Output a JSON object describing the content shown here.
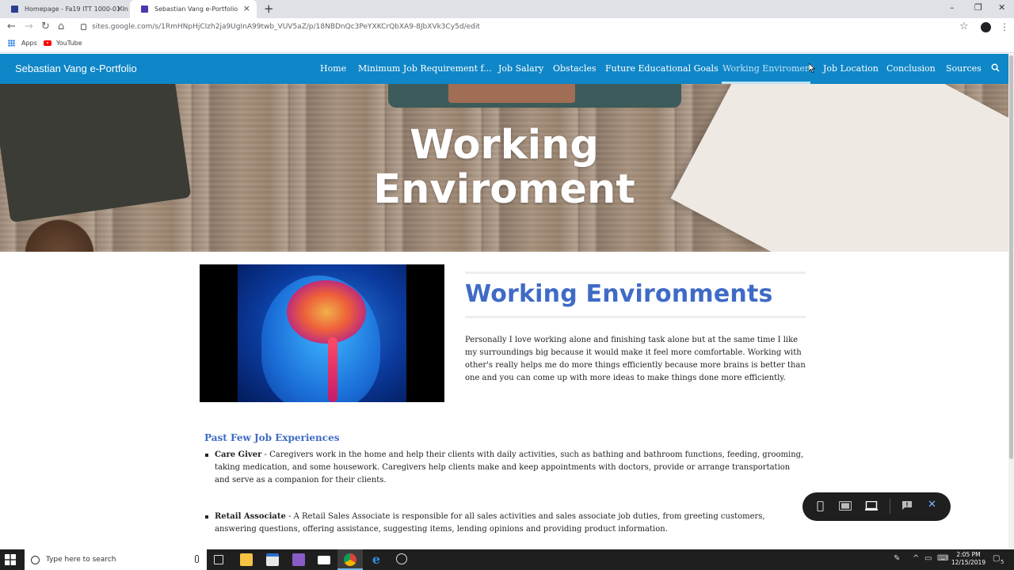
{
  "browser": {
    "tabs": [
      {
        "title": "Homepage - Fa19 ITT 1000-01 In",
        "active": false
      },
      {
        "title": "Sebastian Vang e-Portfolio",
        "active": true
      }
    ],
    "url": "sites.google.com/s/1RmHNpHjCIzh2ja9UgInA99twb_VUV5aZ/p/18NBDnQc3PeYXKCrQbXA9-8JbXVk3Cy5d/edit",
    "bookmarks": [
      "Apps",
      "YouTube"
    ]
  },
  "site": {
    "title": "Sebastian Vang e-Portfolio",
    "nav": [
      "Home",
      "Minimum Job Requirement f...",
      "Job Salary",
      "Obstacles",
      "Future Educational Goals",
      "Working Enviroment",
      "Job Location",
      "Conclusion",
      "Sources"
    ],
    "active_nav": "Working Enviroment"
  },
  "hero": {
    "title_line1": "Working",
    "title_line2": "Enviroment"
  },
  "content": {
    "heading": "Working Environments",
    "paragraph": "Personally I love working alone and finishing task alone but at the same time I like my surroundings big because it would make it feel more comfortable. Working with other's really helps me do more things efficiently because more brains is better than one and you can come up with more ideas to make things done more efficiently.",
    "sub_heading": "Past Few Job Experiences",
    "jobs": [
      {
        "title": "Care Giver",
        "description": " - Caregivers work in the home and help their clients with daily activities, such as bathing and bathroom functions, feeding, grooming, taking medication, and some housework. Caregivers help clients make and keep appointments with doctors, provide or arrange transportation and serve as a companion for their clients."
      },
      {
        "title": "Retail Associate",
        "description": " - A Retail Sales Associate is responsible for all sales activities and sales associate job duties, from greeting customers, answering questions, offering assistance, suggesting items, lending opinions and providing product information."
      }
    ]
  },
  "taskbar": {
    "search_placeholder": "Type here to search",
    "time": "2:05 PM",
    "date": "12/15/2019",
    "notification_count": "5"
  },
  "colors": {
    "header_blue": "#0f86c7",
    "heading_blue": "#3f6bc6"
  }
}
